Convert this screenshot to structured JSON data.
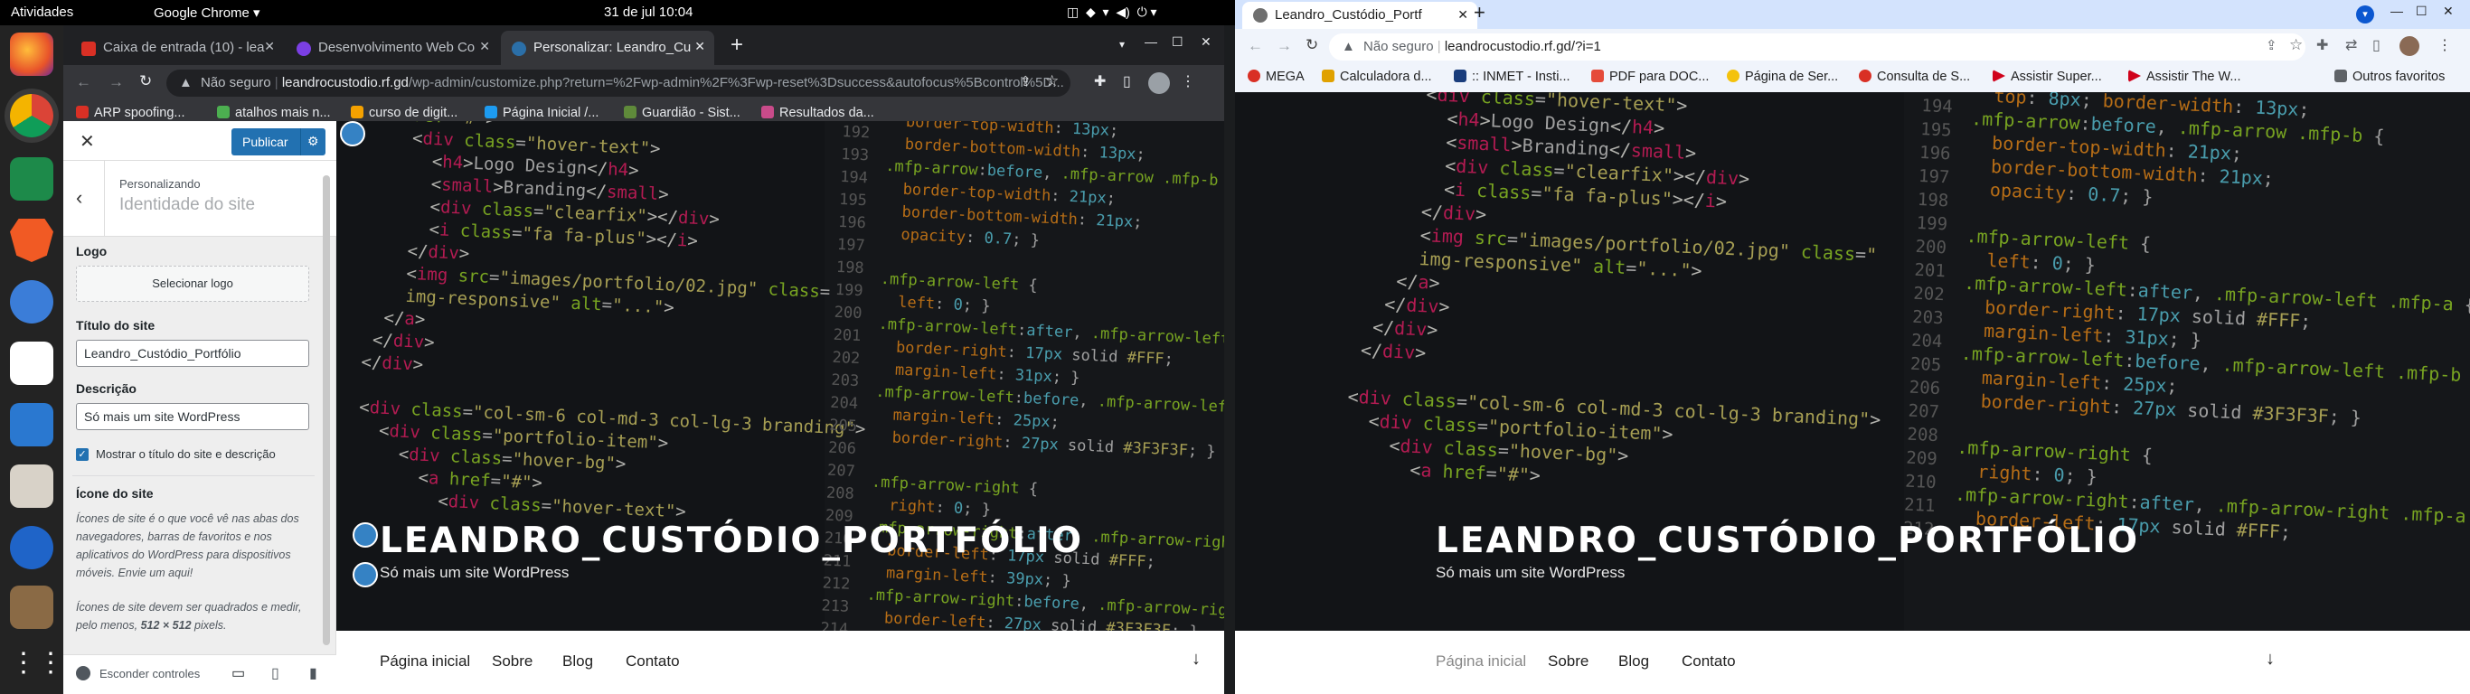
{
  "system": {
    "activities": "Atividades",
    "app_menu": "Google Chrome",
    "clock": "31 de jul  10:04"
  },
  "left_window": {
    "tabs": [
      {
        "label": "Caixa de entrada (10) - lea",
        "favicon_color": "#d93025"
      },
      {
        "label": "Desenvolvimento Web Co",
        "favicon_color": "#7b3fe4"
      },
      {
        "label": "Personalizar: Leandro_Cu",
        "favicon_color": "#2b6fa8"
      }
    ],
    "security": "Não seguro",
    "url_host": "leandrocustodio.rf.gd",
    "url_path": "/wp-admin/customize.php?return=%2Fwp-admin%2F%3Fwp-reset%3Dsuccess&autofocus%5Bcontrol%5D...",
    "bookmarks": [
      "ARP spoofing...",
      "atalhos mais n...",
      "curso de digit...",
      "Página Inicial /...",
      "Guardião - Sist...",
      "Resultados da..."
    ]
  },
  "customizer": {
    "publish_label": "Publicar",
    "breadcrumb": "Personalizando",
    "section_title": "Identidade do site",
    "logo_label": "Logo",
    "select_logo_label": "Selecionar logo",
    "site_title_label": "Título do site",
    "site_title_value": "Leandro_Custódio_Portfólio",
    "description_label": "Descrição",
    "description_value": "Só mais um site WordPress",
    "show_title_label": "Mostrar o título do site e descrição",
    "site_icon_label": "Ícone do site",
    "site_icon_help1": "Ícones de site é o que você vê nas abas dos navegadores, barras de favoritos e nos aplicativos do WordPress para dispositivos móveis. Envie um aqui!",
    "site_icon_help2_a": "Ícones de site devem ser quadrados e medir, pelo menos, ",
    "site_icon_help2_b": "512 × 512",
    "site_icon_help2_c": " pixels.",
    "hide_controls_label": "Esconder controles"
  },
  "site": {
    "title": "LEANDRO_CUSTÓDIO_PORTFÓLIO",
    "description": "Só mais um site WordPress",
    "nav": [
      "Página inicial",
      "Sobre",
      "Blog",
      "Contato"
    ]
  },
  "right_window": {
    "tab_label": "Leandro_Custódio_Portf",
    "security": "Não seguro",
    "url": "leandrocustodio.rf.gd/?i=1",
    "bookmarks": [
      "MEGA",
      "Calculadora d...",
      ":: INMET - Insti...",
      "PDF para DOC...",
      "Página de Ser...",
      "Consulta de S...",
      "Assistir Super...",
      "Assistir The W..."
    ],
    "other_bookmarks": "Outros favoritos"
  },
  "colors": {
    "wp_blue": "#2271b1",
    "dark_chrome": "#202124",
    "light_chrome": "#dee8f7"
  }
}
